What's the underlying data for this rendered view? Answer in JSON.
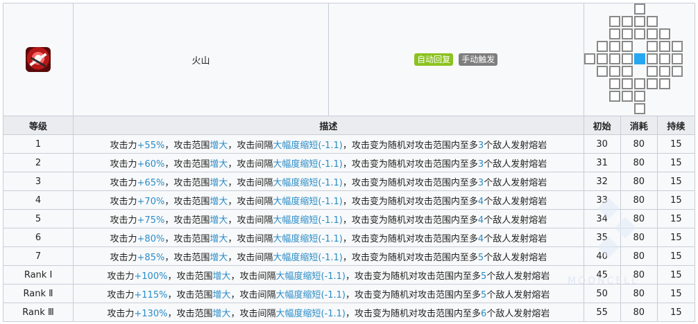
{
  "skill": {
    "icon": "volcano-skill-icon",
    "name": "火山",
    "recovery_tag": "自动回复",
    "trigger_tag": "手动触发",
    "colors": {
      "auto_tag": "#8bc21f",
      "manual_tag": "#7e7e7e",
      "range_center": "#27a6f1",
      "highlight": "#2a8cc7"
    }
  },
  "headers": {
    "level": "等级",
    "description": "描述",
    "initial": "初始",
    "cost": "消耗",
    "duration": "持续"
  },
  "range": {
    "center": [
      4,
      4
    ],
    "cells": [
      [
        4,
        0
      ],
      [
        2,
        1
      ],
      [
        3,
        1
      ],
      [
        4,
        1
      ],
      [
        5,
        1
      ],
      [
        2,
        2
      ],
      [
        3,
        2
      ],
      [
        4,
        2
      ],
      [
        5,
        2
      ],
      [
        6,
        2
      ],
      [
        1,
        3
      ],
      [
        2,
        3
      ],
      [
        3,
        3
      ],
      [
        5,
        3
      ],
      [
        6,
        3
      ],
      [
        7,
        3
      ],
      [
        0,
        4
      ],
      [
        1,
        4
      ],
      [
        2,
        4
      ],
      [
        3,
        4
      ],
      [
        5,
        4
      ],
      [
        6,
        4
      ],
      [
        7,
        4
      ],
      [
        1,
        5
      ],
      [
        2,
        5
      ],
      [
        3,
        5
      ],
      [
        5,
        5
      ],
      [
        6,
        5
      ],
      [
        7,
        5
      ],
      [
        2,
        6
      ],
      [
        3,
        6
      ],
      [
        4,
        6
      ],
      [
        5,
        6
      ],
      [
        6,
        6
      ],
      [
        2,
        7
      ],
      [
        3,
        7
      ],
      [
        4,
        7
      ],
      [
        4,
        8
      ]
    ]
  },
  "rows": [
    {
      "level": "1",
      "desc": {
        "p1": "攻击力",
        "atk": "+55%",
        "p2": "，攻击范围",
        "range": "增大",
        "p3": "，攻击间隔",
        "interval": "大幅度缩短(-1.1)",
        "p4": "，攻击变为随机对攻击范围内至多",
        "count": "3",
        "p5": "个敌人发射熔岩"
      },
      "initial": "30",
      "cost": "80",
      "duration": "15"
    },
    {
      "level": "2",
      "desc": {
        "p1": "攻击力",
        "atk": "+60%",
        "p2": "，攻击范围",
        "range": "增大",
        "p3": "，攻击间隔",
        "interval": "大幅度缩短(-1.1)",
        "p4": "，攻击变为随机对攻击范围内至多",
        "count": "3",
        "p5": "个敌人发射熔岩"
      },
      "initial": "31",
      "cost": "80",
      "duration": "15"
    },
    {
      "level": "3",
      "desc": {
        "p1": "攻击力",
        "atk": "+65%",
        "p2": "，攻击范围",
        "range": "增大",
        "p3": "，攻击间隔",
        "interval": "大幅度缩短(-1.1)",
        "p4": "，攻击变为随机对攻击范围内至多",
        "count": "3",
        "p5": "个敌人发射熔岩"
      },
      "initial": "32",
      "cost": "80",
      "duration": "15"
    },
    {
      "level": "4",
      "desc": {
        "p1": "攻击力",
        "atk": "+70%",
        "p2": "，攻击范围",
        "range": "增大",
        "p3": "，攻击间隔",
        "interval": "大幅度缩短(-1.1)",
        "p4": "，攻击变为随机对攻击范围内至多",
        "count": "4",
        "p5": "个敌人发射熔岩"
      },
      "initial": "33",
      "cost": "80",
      "duration": "15"
    },
    {
      "level": "5",
      "desc": {
        "p1": "攻击力",
        "atk": "+75%",
        "p2": "，攻击范围",
        "range": "增大",
        "p3": "，攻击间隔",
        "interval": "大幅度缩短(-1.1)",
        "p4": "，攻击变为随机对攻击范围内至多",
        "count": "4",
        "p5": "个敌人发射熔岩"
      },
      "initial": "34",
      "cost": "80",
      "duration": "15"
    },
    {
      "level": "6",
      "desc": {
        "p1": "攻击力",
        "atk": "+80%",
        "p2": "，攻击范围",
        "range": "增大",
        "p3": "，攻击间隔",
        "interval": "大幅度缩短(-1.1)",
        "p4": "，攻击变为随机对攻击范围内至多",
        "count": "4",
        "p5": "个敌人发射熔岩"
      },
      "initial": "35",
      "cost": "80",
      "duration": "15"
    },
    {
      "level": "7",
      "desc": {
        "p1": "攻击力",
        "atk": "+85%",
        "p2": "，攻击范围",
        "range": "增大",
        "p3": "，攻击间隔",
        "interval": "大幅度缩短(-1.1)",
        "p4": "，攻击变为随机对攻击范围内至多",
        "count": "5",
        "p5": "个敌人发射熔岩"
      },
      "initial": "40",
      "cost": "80",
      "duration": "15"
    },
    {
      "level": "Rank Ⅰ",
      "desc": {
        "p1": "攻击力",
        "atk": "+100%",
        "p2": "，攻击范围",
        "range": "增大",
        "p3": "，攻击间隔",
        "interval": "大幅度缩短(-1.1)",
        "p4": "，攻击变为随机对攻击范围内至多",
        "count": "5",
        "p5": "个敌人发射熔岩"
      },
      "initial": "45",
      "cost": "80",
      "duration": "15"
    },
    {
      "level": "Rank Ⅱ",
      "desc": {
        "p1": "攻击力",
        "atk": "+115%",
        "p2": "，攻击范围",
        "range": "增大",
        "p3": "，攻击间隔",
        "interval": "大幅度缩短(-1.1)",
        "p4": "，攻击变为随机对攻击范围内至多",
        "count": "5",
        "p5": "个敌人发射熔岩"
      },
      "initial": "50",
      "cost": "80",
      "duration": "15"
    },
    {
      "level": "Rank Ⅲ",
      "desc": {
        "p1": "攻击力",
        "atk": "+130%",
        "p2": "，攻击范围",
        "range": "增大",
        "p3": "，攻击间隔",
        "interval": "大幅度缩短(-1.1)",
        "p4": "，攻击变为随机对攻击范围内至多",
        "count": "6",
        "p5": "个敌人发射熔岩"
      },
      "initial": "55",
      "cost": "80",
      "duration": "15"
    }
  ],
  "watermark": "MOONCELL"
}
